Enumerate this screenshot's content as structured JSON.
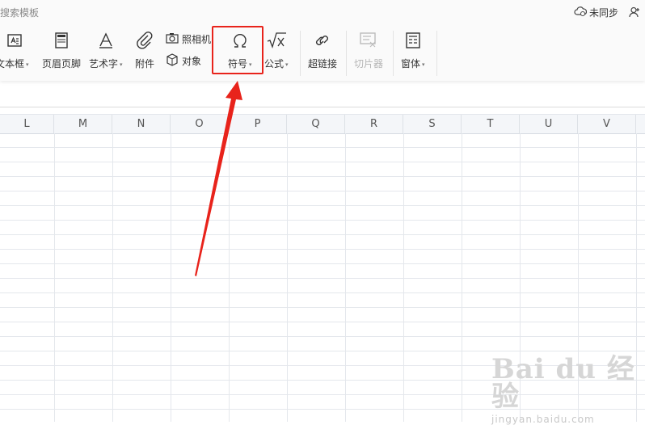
{
  "ribbon": {
    "search_hint": "搜索模板",
    "sync_label": "未同步",
    "tools": {
      "textbox": "文本框",
      "header_footer": "页眉页脚",
      "wordart": "艺术字",
      "attachment": "附件",
      "camera": "照相机",
      "object": "对象",
      "symbol": "符号",
      "formula": "公式",
      "hyperlink": "超链接",
      "slicer": "切片器",
      "form": "窗体"
    },
    "caret": "▾"
  },
  "columns": [
    "L",
    "M",
    "N",
    "O",
    "P",
    "Q",
    "R",
    "S",
    "T",
    "U",
    "V"
  ],
  "watermark": {
    "brand": "Bai du 经验",
    "url": "jingyan.baidu.com"
  },
  "colors": {
    "highlight": "#e8231b",
    "grid_line": "#e4e7ec",
    "header_bg": "#f4f6f9"
  }
}
